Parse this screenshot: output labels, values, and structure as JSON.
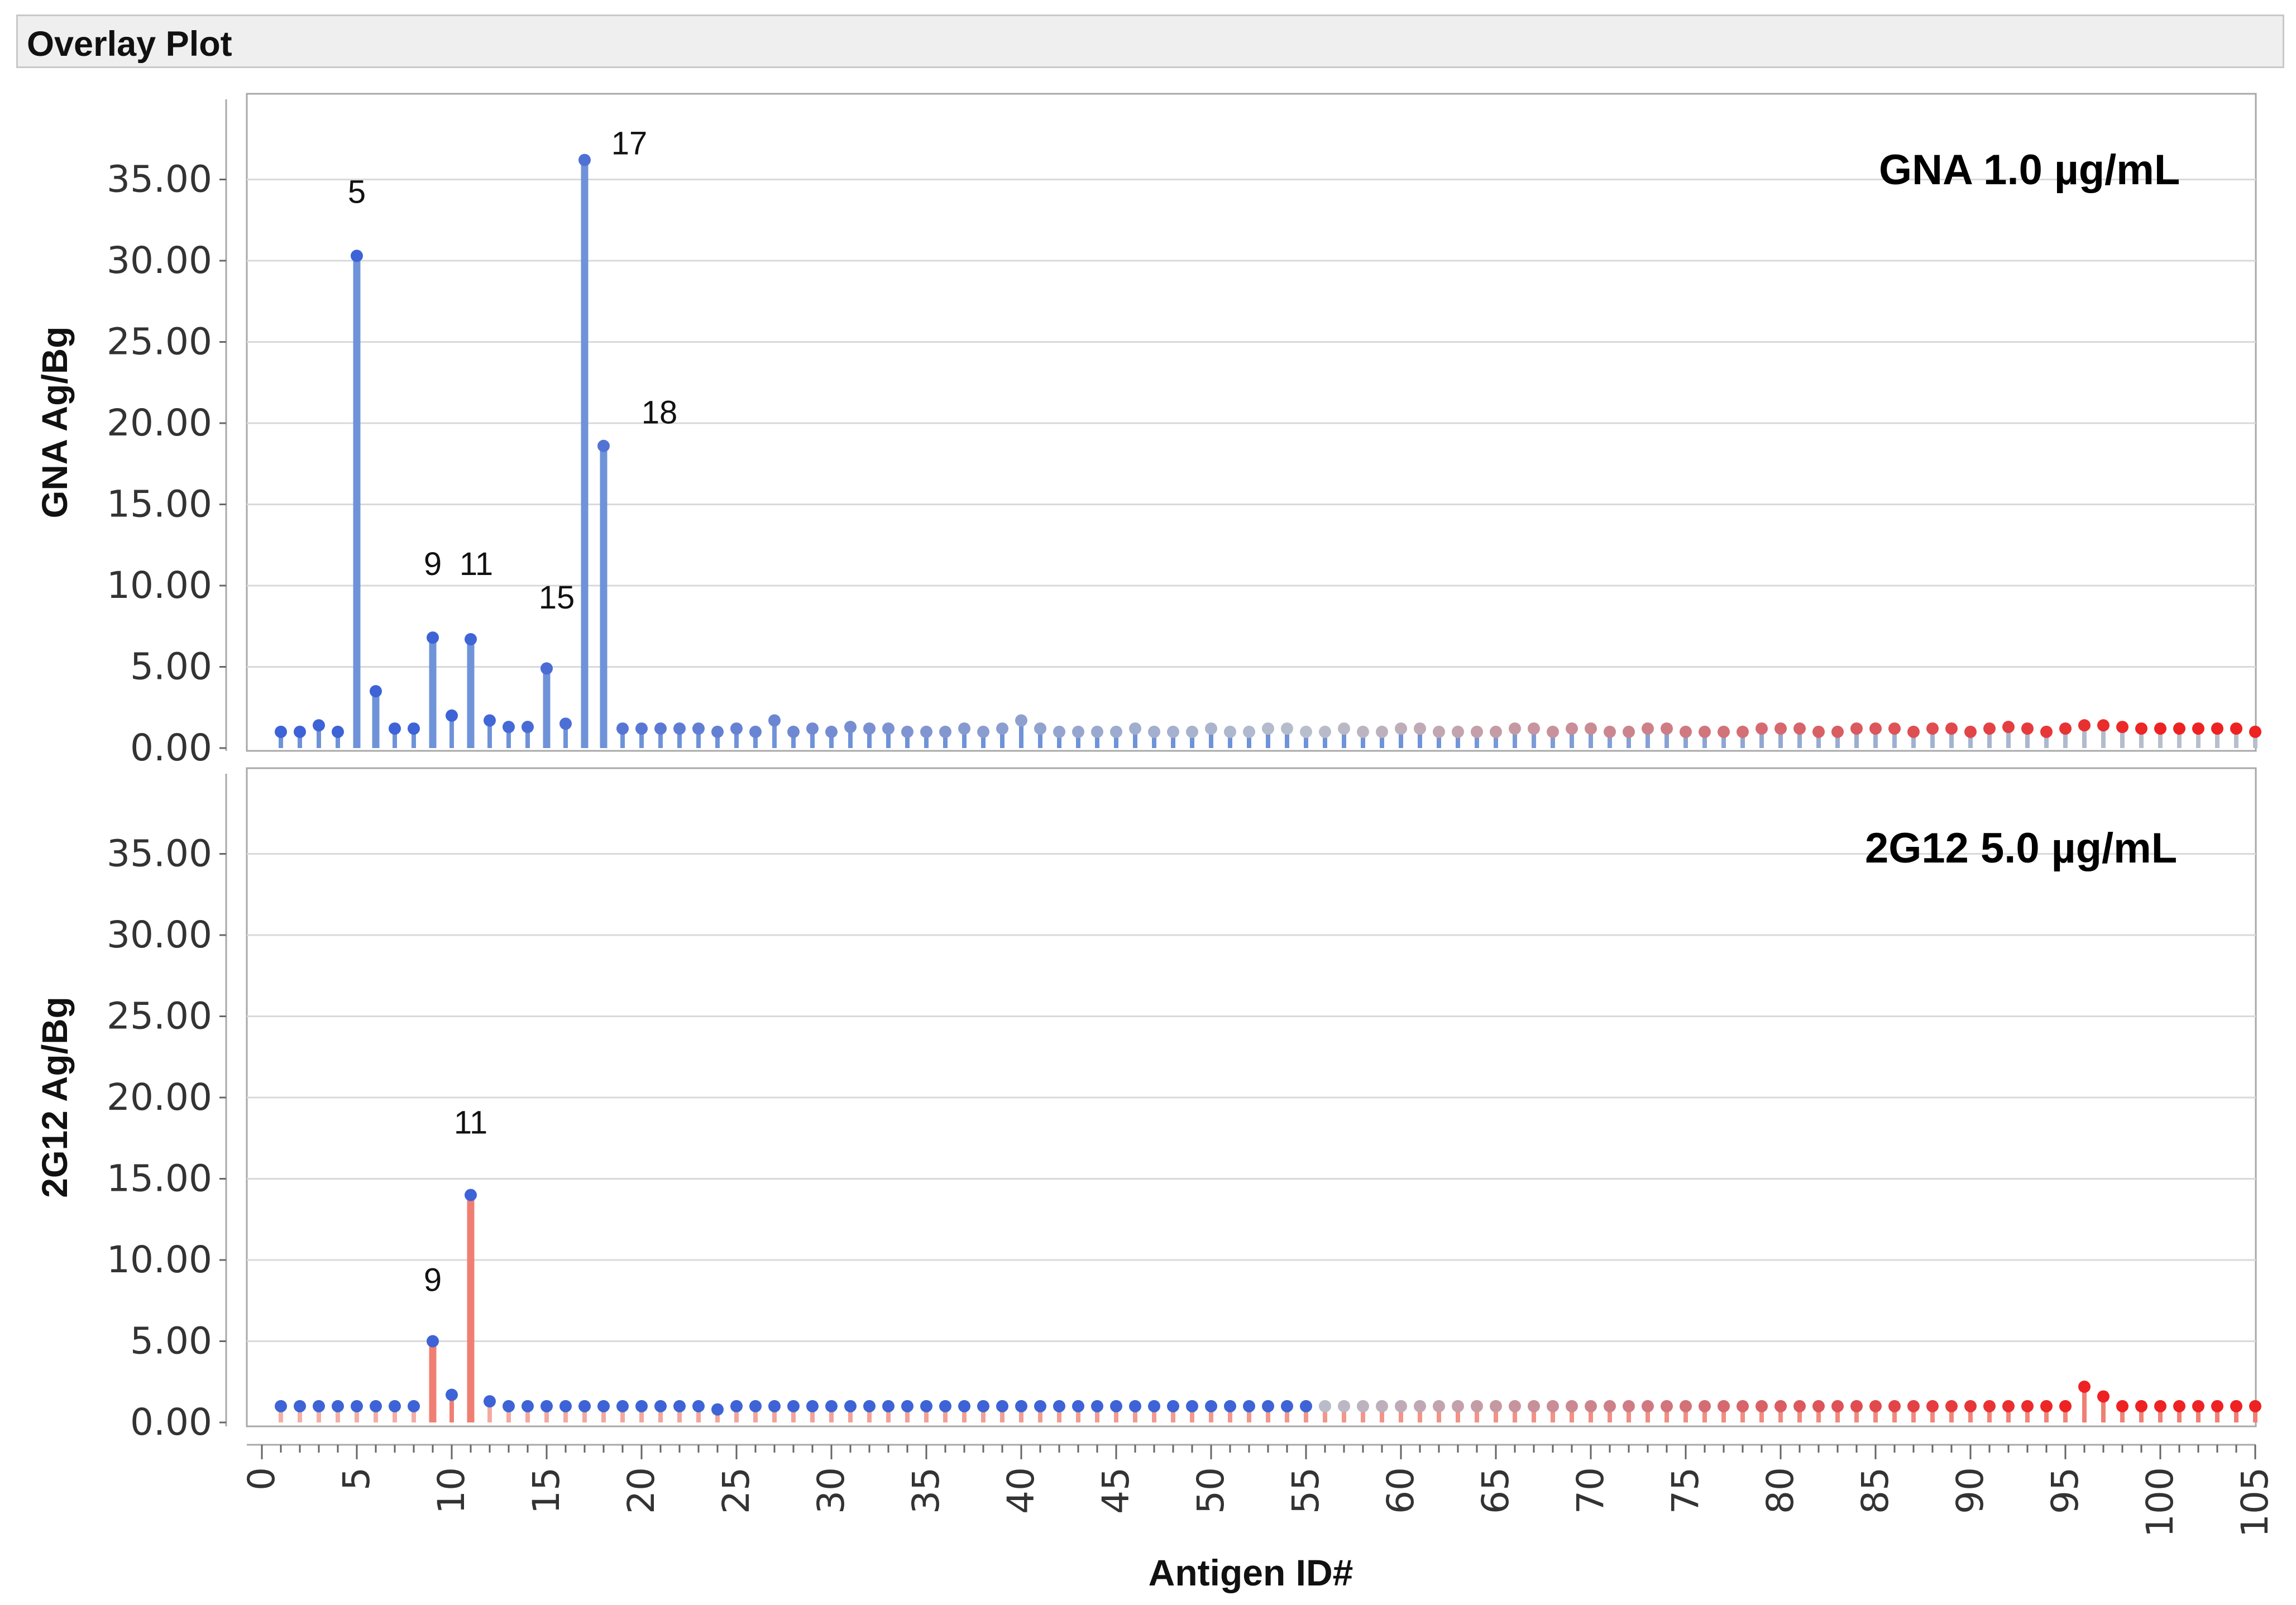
{
  "panel": {
    "title": "Overlay Plot"
  },
  "chart_data": [
    {
      "type": "bar",
      "style": "needle",
      "panel_label": "GNA 1.0 µg/mL",
      "ylabel": "GNA Ag/Bg",
      "xlabel": "",
      "ylim": [
        0,
        40
      ],
      "yticks": [
        "0.00",
        "5.00",
        "10.00",
        "15.00",
        "20.00",
        "25.00",
        "30.00",
        "35.00"
      ],
      "grid": true,
      "peak_labels": [
        {
          "x": 5,
          "text": "5"
        },
        {
          "x": 9,
          "text": "9"
        },
        {
          "x": 11,
          "text": "11"
        },
        {
          "x": 15,
          "text": "15"
        },
        {
          "x": 17,
          "text": "17"
        },
        {
          "x": 18,
          "text": "18"
        }
      ],
      "x": [
        1,
        2,
        3,
        4,
        5,
        6,
        7,
        8,
        9,
        10,
        11,
        12,
        13,
        14,
        15,
        16,
        17,
        18,
        19,
        20,
        21,
        22,
        23,
        24,
        25,
        26,
        27,
        28,
        29,
        30,
        31,
        32,
        33,
        34,
        35,
        36,
        37,
        38,
        39,
        40,
        41,
        42,
        43,
        44,
        45,
        46,
        47,
        48,
        49,
        50,
        51,
        52,
        53,
        54,
        55,
        56,
        57,
        58,
        59,
        60,
        61,
        62,
        63,
        64,
        65,
        66,
        67,
        68,
        69,
        70,
        71,
        72,
        73,
        74,
        75,
        76,
        77,
        78,
        79,
        80,
        81,
        82,
        83,
        84,
        85,
        86,
        87,
        88,
        89,
        90,
        91,
        92,
        93,
        94,
        95,
        96,
        97,
        98,
        99,
        100,
        101,
        102,
        103,
        104,
        105
      ],
      "values": [
        1.0,
        1.0,
        1.4,
        1.0,
        30.3,
        3.5,
        1.2,
        1.2,
        6.8,
        2.0,
        6.7,
        1.7,
        1.3,
        1.3,
        4.9,
        1.5,
        36.2,
        18.6,
        1.2,
        1.2,
        1.2,
        1.2,
        1.2,
        1.0,
        1.2,
        1.0,
        1.7,
        1.0,
        1.2,
        1.0,
        1.3,
        1.2,
        1.2,
        1.0,
        1.0,
        1.0,
        1.2,
        1.0,
        1.2,
        1.7,
        1.2,
        1.0,
        1.0,
        1.0,
        1.0,
        1.2,
        1.0,
        1.0,
        1.0,
        1.2,
        1.0,
        1.0,
        1.2,
        1.2,
        1.0,
        1.0,
        1.2,
        1.0,
        1.0,
        1.2,
        1.2,
        1.0,
        1.0,
        1.0,
        1.0,
        1.2,
        1.2,
        1.0,
        1.2,
        1.2,
        1.0,
        1.0,
        1.2,
        1.2,
        1.0,
        1.0,
        1.0,
        1.0,
        1.2,
        1.2,
        1.2,
        1.0,
        1.0,
        1.2,
        1.2,
        1.2,
        1.0,
        1.2,
        1.2,
        1.0,
        1.2,
        1.3,
        1.2,
        1.0,
        1.2,
        1.4,
        1.4,
        1.3,
        1.2,
        1.2,
        1.2,
        1.2,
        1.2,
        1.2,
        1.0
      ]
    },
    {
      "type": "bar",
      "style": "needle",
      "panel_label": "2G12 5.0 µg/mL",
      "ylabel": "2G12 Ag/Bg",
      "xlabel": "Antigen ID#",
      "ylim": [
        0,
        40
      ],
      "xlim": [
        0,
        105
      ],
      "yticks": [
        "0.00",
        "5.00",
        "10.00",
        "15.00",
        "20.00",
        "25.00",
        "30.00",
        "35.00"
      ],
      "xticks": [
        "0",
        "5",
        "10",
        "15",
        "20",
        "25",
        "30",
        "35",
        "40",
        "45",
        "50",
        "55",
        "60",
        "65",
        "70",
        "75",
        "80",
        "85",
        "90",
        "95",
        "100",
        "105"
      ],
      "grid": true,
      "peak_labels": [
        {
          "x": 9,
          "text": "9"
        },
        {
          "x": 11,
          "text": "11"
        }
      ],
      "x": [
        1,
        2,
        3,
        4,
        5,
        6,
        7,
        8,
        9,
        10,
        11,
        12,
        13,
        14,
        15,
        16,
        17,
        18,
        19,
        20,
        21,
        22,
        23,
        24,
        25,
        26,
        27,
        28,
        29,
        30,
        31,
        32,
        33,
        34,
        35,
        36,
        37,
        38,
        39,
        40,
        41,
        42,
        43,
        44,
        45,
        46,
        47,
        48,
        49,
        50,
        51,
        52,
        53,
        54,
        55,
        56,
        57,
        58,
        59,
        60,
        61,
        62,
        63,
        64,
        65,
        66,
        67,
        68,
        69,
        70,
        71,
        72,
        73,
        74,
        75,
        76,
        77,
        78,
        79,
        80,
        81,
        82,
        83,
        84,
        85,
        86,
        87,
        88,
        89,
        90,
        91,
        92,
        93,
        94,
        95,
        96,
        97,
        98,
        99,
        100,
        101,
        102,
        103,
        104,
        105
      ],
      "values": [
        1.0,
        1.0,
        1.0,
        1.0,
        1.0,
        1.0,
        1.0,
        1.0,
        5.0,
        1.7,
        14.0,
        1.3,
        1.0,
        1.0,
        1.0,
        1.0,
        1.0,
        1.0,
        1.0,
        1.0,
        1.0,
        1.0,
        1.0,
        0.8,
        1.0,
        1.0,
        1.0,
        1.0,
        1.0,
        1.0,
        1.0,
        1.0,
        1.0,
        1.0,
        1.0,
        1.0,
        1.0,
        1.0,
        1.0,
        1.0,
        1.0,
        1.0,
        1.0,
        1.0,
        1.0,
        1.0,
        1.0,
        1.0,
        1.0,
        1.0,
        1.0,
        1.0,
        1.0,
        1.0,
        1.0,
        1.0,
        1.0,
        1.0,
        1.0,
        1.0,
        1.0,
        1.0,
        1.0,
        1.0,
        1.0,
        1.0,
        1.0,
        1.0,
        1.0,
        1.0,
        1.0,
        1.0,
        1.0,
        1.0,
        1.0,
        1.0,
        1.0,
        1.0,
        1.0,
        1.0,
        1.0,
        1.0,
        1.0,
        1.0,
        1.0,
        1.0,
        1.0,
        1.0,
        1.0,
        1.0,
        1.0,
        1.0,
        1.0,
        1.0,
        1.0,
        2.2,
        1.6,
        1.0,
        1.0,
        1.0,
        1.0,
        1.0,
        1.0,
        1.0,
        1.0
      ]
    }
  ],
  "colors": {
    "blue_stem": "#6f93d8",
    "blue_dot": "#3d63d6",
    "gray_dot": "#b8bfcc",
    "red_stem": "#f07f73",
    "red_dot": "#ee2222",
    "grid": "#d9d9d9",
    "frame": "#a8a8a8"
  }
}
